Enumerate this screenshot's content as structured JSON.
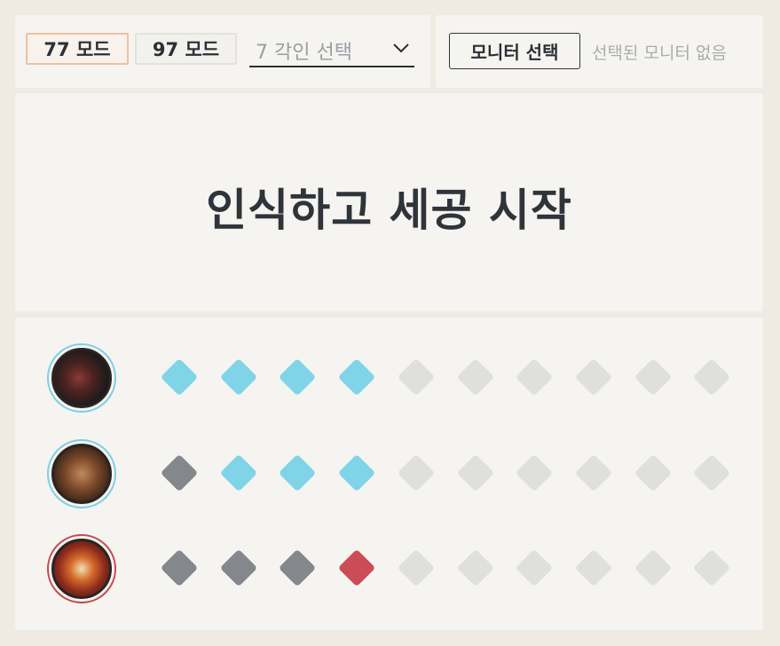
{
  "mode_buttons": [
    {
      "label": "77 모드",
      "active": true
    },
    {
      "label": "97 모드",
      "active": false
    }
  ],
  "angle_select": {
    "value": "7 각인 선택"
  },
  "monitor": {
    "button_label": "모니터 선택",
    "status": "선택된 모니터 없음"
  },
  "start": {
    "label": "인식하고 세공 시작"
  },
  "colors": {
    "success": "#7fd4e8",
    "fail": "#84878b",
    "danger": "#cb4c57",
    "empty": "#dfdfde",
    "active_border": "#efc0a2"
  },
  "engraving_rows": [
    {
      "icon": "engraving-icon-1",
      "ring": "blue",
      "slots": [
        "success",
        "success",
        "success",
        "success",
        "empty",
        "empty",
        "empty",
        "empty",
        "empty",
        "empty"
      ]
    },
    {
      "icon": "engraving-icon-2",
      "ring": "blue",
      "slots": [
        "fail",
        "success",
        "success",
        "success",
        "empty",
        "empty",
        "empty",
        "empty",
        "empty",
        "empty"
      ]
    },
    {
      "icon": "engraving-icon-3",
      "ring": "red",
      "slots": [
        "fail",
        "fail",
        "fail",
        "danger",
        "empty",
        "empty",
        "empty",
        "empty",
        "empty",
        "empty"
      ]
    }
  ]
}
